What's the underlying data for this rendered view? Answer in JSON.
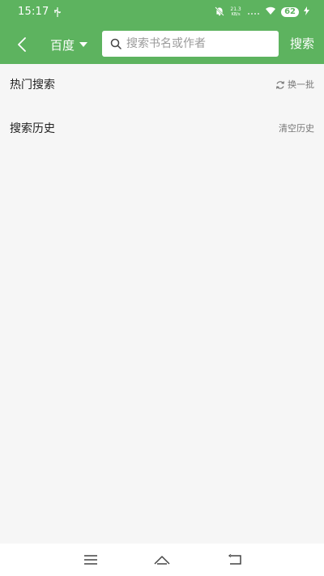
{
  "status_bar": {
    "time": "15:17",
    "net_speed_value": "21.3",
    "net_speed_unit": "KB/s",
    "battery": "62"
  },
  "toolbar": {
    "engine_label": "百度",
    "search_placeholder": "搜索书名或作者",
    "search_value": "",
    "search_button_label": "搜索"
  },
  "hot_search": {
    "title": "热门搜索",
    "action_label": "换一批"
  },
  "history": {
    "title": "搜索历史",
    "action_label": "清空历史"
  },
  "colors": {
    "accent": "#5db35f"
  }
}
